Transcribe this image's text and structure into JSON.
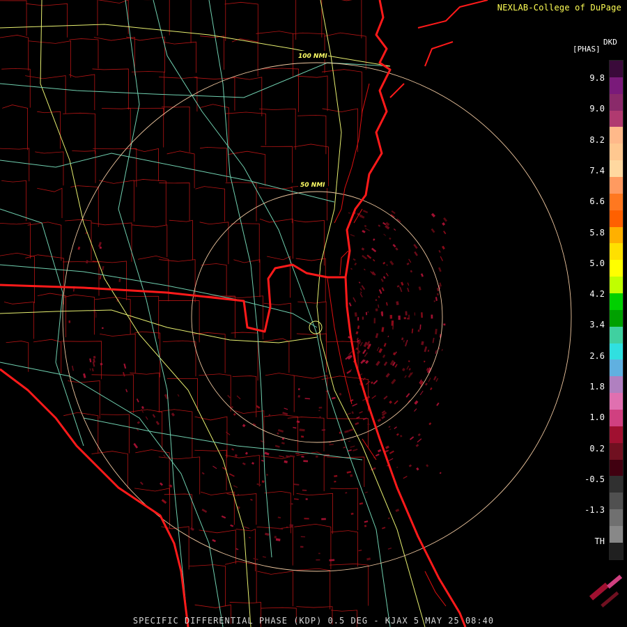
{
  "credit": "NEXLAB-College of DuPage",
  "footer": "SPECIFIC DIFFERENTIAL PHASE (KDP) 0.5 DEG - KJAX 5 MAY 25 08:40",
  "legend": {
    "product": "DKD",
    "units": "[PHAS]",
    "ticks": [
      "9.8",
      "9.0",
      "8.2",
      "7.4",
      "6.6",
      "5.8",
      "5.0",
      "4.2",
      "3.4",
      "2.6",
      "1.8",
      "1.0",
      "0.2",
      "-0.5",
      "-1.3",
      "TH"
    ],
    "colors": [
      "#3a0a3a",
      "#7a1a7a",
      "#8a2a6a",
      "#b03a70",
      "#ffb98a",
      "#ffc890",
      "#ffd8a0",
      "#ff9a60",
      "#ff7820",
      "#ff6000",
      "#ffb000",
      "#ffe000",
      "#ffff00",
      "#c0ff00",
      "#00d000",
      "#00a000",
      "#40d0a0",
      "#30e0e0",
      "#60b0e0",
      "#b080c0",
      "#e070b0",
      "#d04080",
      "#a01030",
      "#701020",
      "#400010",
      "#303030",
      "#505050",
      "#707070",
      "#888888",
      "#202020"
    ]
  },
  "rings": [
    {
      "label": "100 NMI"
    },
    {
      "label": "50 NMI"
    }
  ],
  "colors": {
    "coast": "#ff1a1a",
    "county": "#c01818",
    "highway": "#e8f070",
    "road": "#70d0b0",
    "ring": "#f0c8a0",
    "echo": "#8a0a18"
  }
}
